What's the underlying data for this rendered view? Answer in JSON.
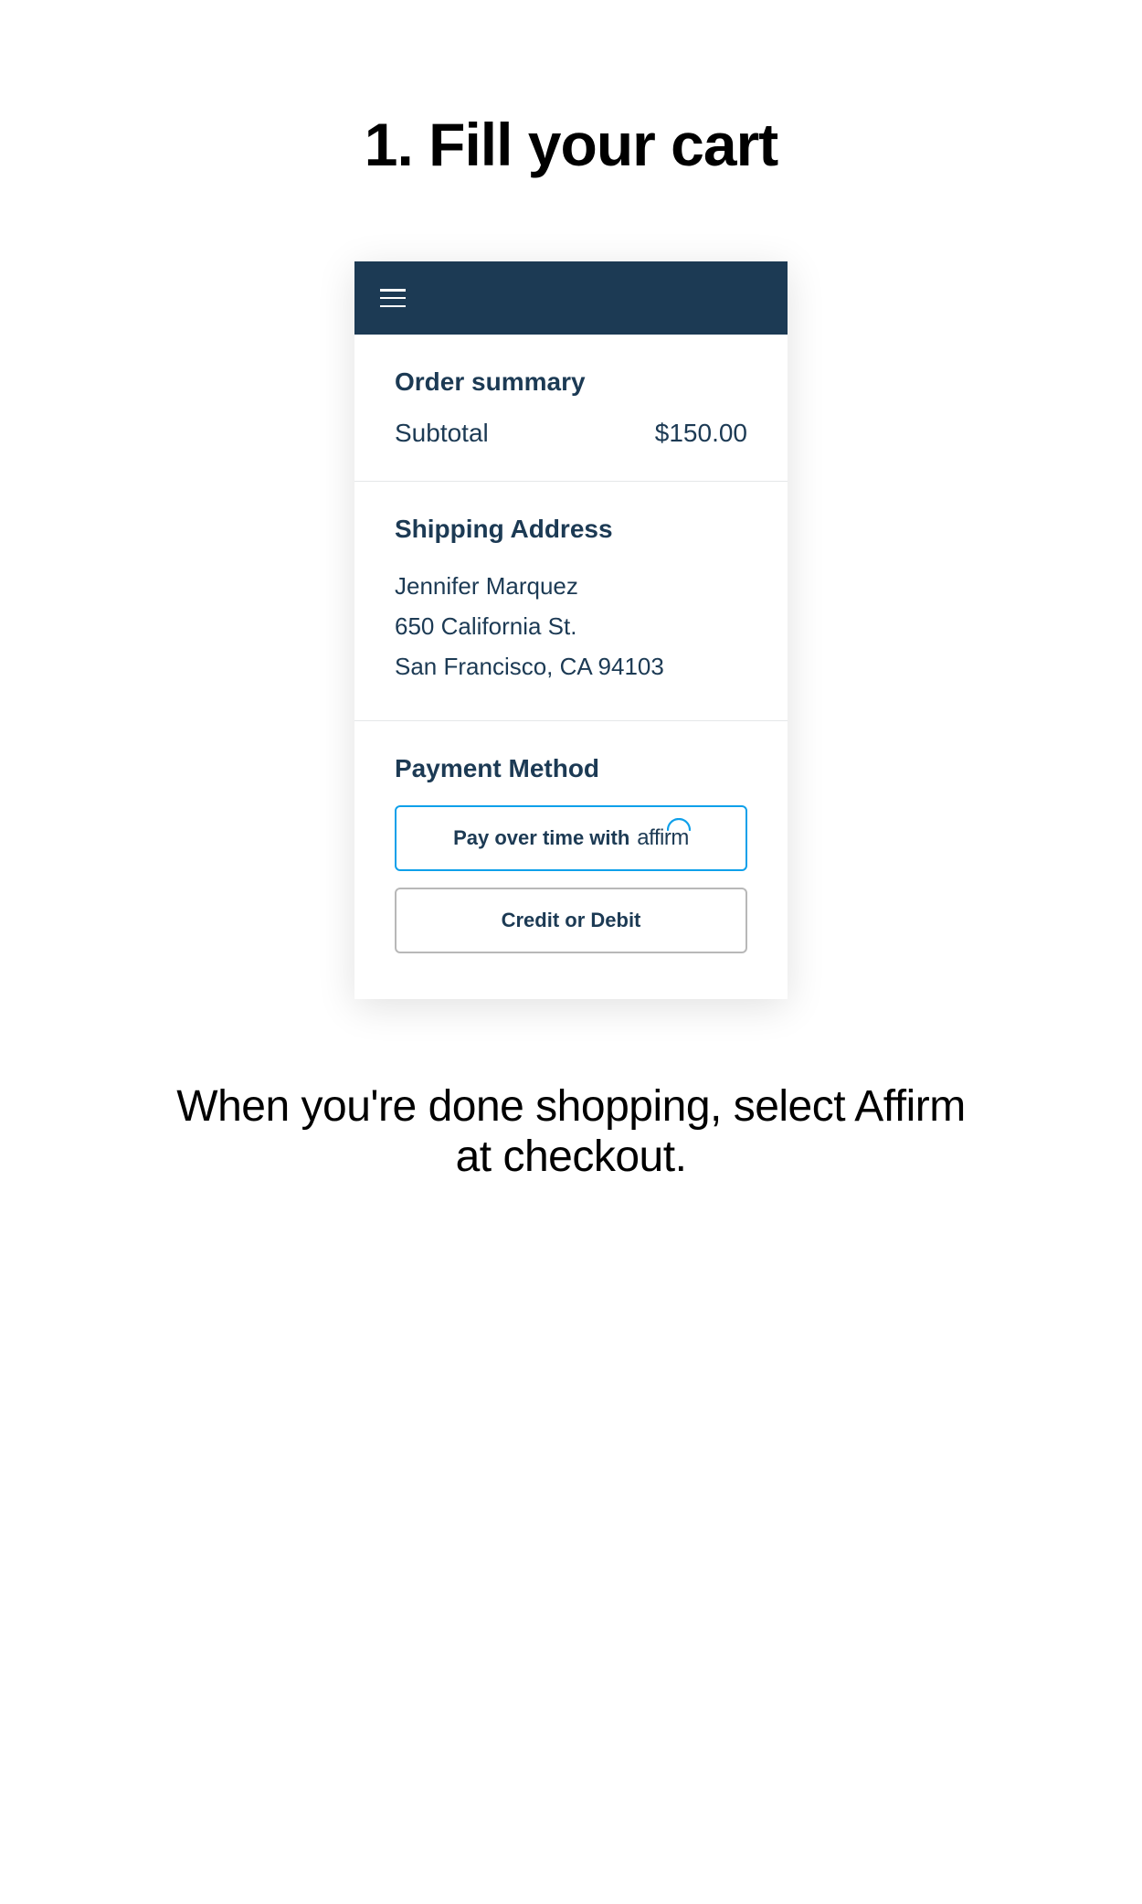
{
  "step": {
    "title": "1. Fill your cart"
  },
  "orderSummary": {
    "title": "Order summary",
    "subtotalLabel": "Subtotal",
    "subtotalValue": "$150.00"
  },
  "shipping": {
    "title": "Shipping Address",
    "name": "Jennifer Marquez",
    "street": "650 California St.",
    "cityStateZip": "San Francisco, CA 94103"
  },
  "payment": {
    "title": "Payment Method",
    "affirmLabel": "Pay over time with",
    "affirmBrand": "affirm",
    "creditLabel": "Credit or Debit"
  },
  "description": "When you're done shopping, select Affirm at checkout."
}
